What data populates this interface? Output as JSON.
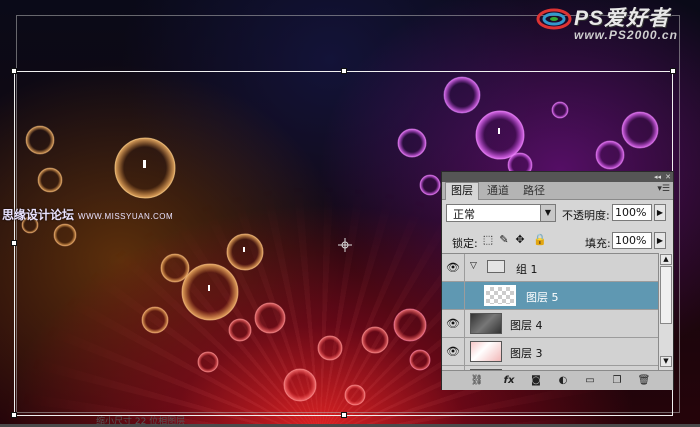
{
  "logo": {
    "title": "PS爱好者",
    "url": "www.PS2000.cn"
  },
  "watermark": {
    "text": "思缘设计论坛",
    "url": "WWW.MISSYUAN.COM"
  },
  "footer": {
    "text": "缩小尺寸 22 位相图层"
  },
  "layers_panel": {
    "tabs": [
      {
        "label": "图层",
        "active": true
      },
      {
        "label": "通道",
        "active": false
      },
      {
        "label": "路径",
        "active": false
      }
    ],
    "blend_mode": "正常",
    "opacity_label": "不透明度:",
    "opacity_value": "100%",
    "lock_label": "锁定:",
    "fill_label": "填充:",
    "fill_value": "100%",
    "layers": [
      {
        "name": "组 1",
        "type": "group"
      },
      {
        "name": "图层 5",
        "type": "layer",
        "selected": true
      },
      {
        "name": "图层 4",
        "type": "layer"
      },
      {
        "name": "图层 3",
        "type": "layer"
      }
    ],
    "accent_color": "#5f98b2"
  }
}
